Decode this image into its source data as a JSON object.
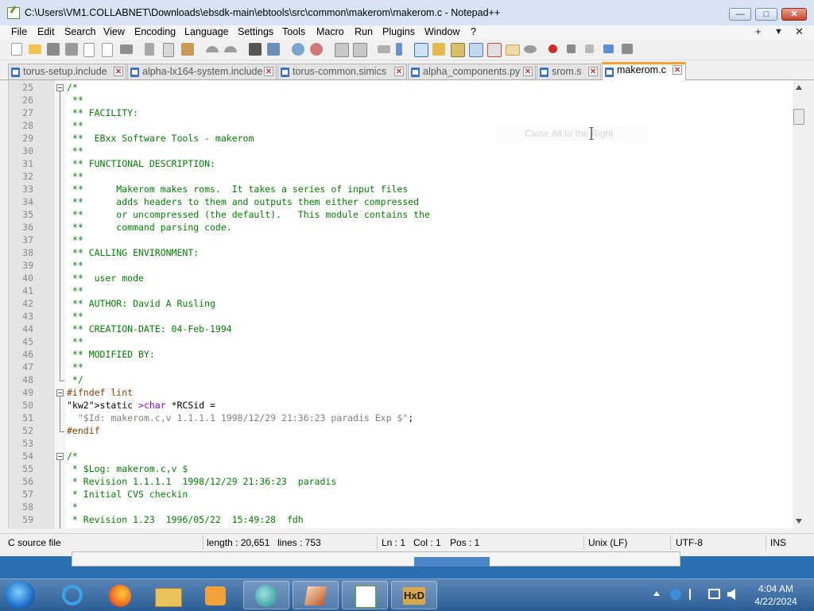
{
  "window": {
    "title": "C:\\Users\\VM1.COLLABNET\\Downloads\\ebsdk-main\\ebtools\\src\\common\\makerom\\makerom.c - Notepad++",
    "minimize_label": "—",
    "maximize_label": "□",
    "close_label": "✕"
  },
  "menu": {
    "items": [
      "File",
      "Edit",
      "Search",
      "View",
      "Encoding",
      "Language",
      "Settings",
      "Tools",
      "Macro",
      "Run",
      "Plugins",
      "Window",
      "?"
    ],
    "right": [
      "+",
      "▼",
      "✕"
    ]
  },
  "toolbar": {
    "icons": [
      "new-file-icon",
      "open-file-icon",
      "save-icon",
      "save-all-icon",
      "close-icon",
      "close-all-icon",
      "print-icon",
      "cut-icon",
      "copy-icon",
      "paste-icon",
      "undo-icon",
      "redo-icon",
      "find-icon",
      "replace-icon",
      "zoom-in-icon",
      "zoom-out-icon",
      "sync-vertical-icon",
      "sync-horizontal-icon",
      "word-wrap-icon",
      "show-all-chars-icon",
      "indent-guide-icon",
      "language-icon",
      "doc-map-icon",
      "function-list-icon",
      "folder-workspace-icon",
      "monitor-icon",
      "record-macro-icon",
      "stop-macro-icon",
      "play-macro-icon",
      "run-macro-multiple-icon",
      "save-macro-icon"
    ]
  },
  "tabs": [
    {
      "label": "torus-setup.include",
      "active": false
    },
    {
      "label": "alpha-lx164-system.include",
      "active": false
    },
    {
      "label": "torus-common.simics",
      "active": false
    },
    {
      "label": "alpha_components.py",
      "active": false
    },
    {
      "label": "srom.s",
      "active": false
    },
    {
      "label": "makerom.c",
      "active": true
    }
  ],
  "editor": {
    "lines": [
      {
        "n": "25",
        "t": "/*"
      },
      {
        "n": "26",
        "t": " **"
      },
      {
        "n": "27",
        "t": " ** FACILITY:"
      },
      {
        "n": "28",
        "t": " **"
      },
      {
        "n": "29",
        "t": " **  EBxx Software Tools - makerom"
      },
      {
        "n": "30",
        "t": " **"
      },
      {
        "n": "31",
        "t": " ** FUNCTIONAL DESCRIPTION:"
      },
      {
        "n": "32",
        "t": " **"
      },
      {
        "n": "33",
        "t": " **      Makerom makes roms.  It takes a series of input files"
      },
      {
        "n": "34",
        "t": " **      adds headers to them and outputs them either compressed"
      },
      {
        "n": "35",
        "t": " **      or uncompressed (the default).   This module contains the"
      },
      {
        "n": "36",
        "t": " **      command parsing code."
      },
      {
        "n": "37",
        "t": " **"
      },
      {
        "n": "38",
        "t": " ** CALLING ENVIRONMENT:"
      },
      {
        "n": "39",
        "t": " **"
      },
      {
        "n": "40",
        "t": " **  user mode"
      },
      {
        "n": "41",
        "t": " **"
      },
      {
        "n": "42",
        "t": " ** AUTHOR: David A Rusling"
      },
      {
        "n": "43",
        "t": " **"
      },
      {
        "n": "44",
        "t": " ** CREATION-DATE: 04-Feb-1994"
      },
      {
        "n": "45",
        "t": " **"
      },
      {
        "n": "46",
        "t": " ** MODIFIED BY:"
      },
      {
        "n": "47",
        "t": " **"
      },
      {
        "n": "48",
        "t": " */"
      },
      {
        "n": "49",
        "t": "#ifndef lint"
      },
      {
        "n": "50",
        "t": "static char *RCSid ="
      },
      {
        "n": "51",
        "t": "  \"$Id: makerom.c,v 1.1.1.1 1998/12/29 21:36:23 paradis Exp $\";"
      },
      {
        "n": "52",
        "t": "#endif"
      },
      {
        "n": "53",
        "t": ""
      },
      {
        "n": "54",
        "t": "/*"
      },
      {
        "n": "55",
        "t": " * $Log: makerom.c,v $"
      },
      {
        "n": "56",
        "t": " * Revision 1.1.1.1  1998/12/29 21:36:23  paradis"
      },
      {
        "n": "57",
        "t": " * Initial CVS checkin"
      },
      {
        "n": "58",
        "t": " *"
      },
      {
        "n": "59",
        "t": " * Revision 1.23  1996/05/22  15:49:28  fdh"
      }
    ],
    "ghost_tooltip": "Close All to the Right"
  },
  "status": {
    "file_type": "C source file",
    "length": "length : 20,651",
    "lines": "lines : 753",
    "ln": "Ln : 1",
    "col": "Col : 1",
    "pos": "Pos : 1",
    "eol": "Unix (LF)",
    "encoding": "UTF-8",
    "mode": "INS"
  },
  "taskbar": {
    "apps": [
      "start-button",
      "internet-explorer-icon",
      "firefox-icon",
      "file-explorer-icon",
      "media-player-icon",
      "browser-icon",
      "matlab-icon",
      "notepadpp-icon",
      "hxd-icon"
    ],
    "time": "4:04 AM",
    "date": "4/22/2024"
  },
  "colors": {
    "comment": "#008000",
    "preprocessor": "#804000",
    "keyword": "#8000ff",
    "string": "#808080",
    "active_tab_accent": "#f3a02e",
    "taskbar": "#2b5d94"
  }
}
